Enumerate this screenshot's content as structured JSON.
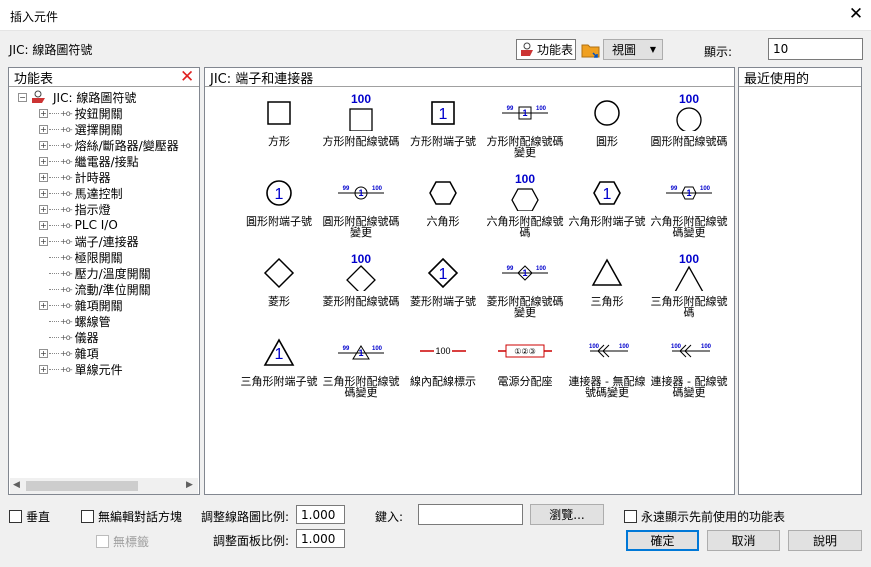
{
  "window": {
    "title": "插入元件",
    "close": "✕"
  },
  "header": {
    "library": "JIC: 線路圖符號",
    "menu_button": "功能表",
    "view_button": "視圖",
    "display_label": "顯示:",
    "display_value": "10"
  },
  "left_panel": {
    "title": "功能表",
    "root": "JIC: 線路圖符號",
    "items": [
      {
        "label": "按鈕開關",
        "expandable": true
      },
      {
        "label": "選擇開關",
        "expandable": true
      },
      {
        "label": "熔絲/斷路器/變壓器",
        "expandable": true
      },
      {
        "label": "繼電器/接點",
        "expandable": true
      },
      {
        "label": "計時器",
        "expandable": true
      },
      {
        "label": "馬達控制",
        "expandable": true
      },
      {
        "label": "指示燈",
        "expandable": true
      },
      {
        "label": "PLC I/O",
        "expandable": true
      },
      {
        "label": "端子/連接器",
        "expandable": true
      },
      {
        "label": "極限開關",
        "expandable": false
      },
      {
        "label": "壓力/溫度開關",
        "expandable": false
      },
      {
        "label": "流動/準位開關",
        "expandable": false
      },
      {
        "label": "雜項開關",
        "expandable": true
      },
      {
        "label": "螺線管",
        "expandable": false
      },
      {
        "label": "儀器",
        "expandable": false
      },
      {
        "label": "雜項",
        "expandable": true
      },
      {
        "label": "單線元件",
        "expandable": true
      }
    ]
  },
  "center_panel": {
    "title": "JIC: 端子和連接器",
    "symbols": [
      {
        "icon": "square-icon",
        "label": "方形"
      },
      {
        "icon": "square-wire-number-icon",
        "label": "方形附配線號碼"
      },
      {
        "icon": "square-terminal-number-icon",
        "label": "方形附端子號"
      },
      {
        "icon": "square-wire-number-change-icon",
        "label": "方形附配線號碼變更"
      },
      {
        "icon": "circle-icon",
        "label": "圓形"
      },
      {
        "icon": "circle-wire-number-icon",
        "label": "圓形附配線號碼"
      },
      {
        "icon": "circle-terminal-number-icon",
        "label": "圓形附端子號"
      },
      {
        "icon": "circle-wire-number-change-icon",
        "label": "圓形附配線號碼變更"
      },
      {
        "icon": "hexagon-icon",
        "label": "六角形"
      },
      {
        "icon": "hexagon-wire-number-icon",
        "label": "六角形附配線號碼"
      },
      {
        "icon": "hexagon-terminal-number-icon",
        "label": "六角形附端子號"
      },
      {
        "icon": "hexagon-wire-number-change-icon",
        "label": "六角形附配線號碼變更"
      },
      {
        "icon": "diamond-icon",
        "label": "菱形"
      },
      {
        "icon": "diamond-wire-number-icon",
        "label": "菱形附配線號碼"
      },
      {
        "icon": "diamond-terminal-number-icon",
        "label": "菱形附端子號"
      },
      {
        "icon": "diamond-wire-number-change-icon",
        "label": "菱形附配線號碼變更"
      },
      {
        "icon": "triangle-icon",
        "label": "三角形"
      },
      {
        "icon": "triangle-wire-number-icon",
        "label": "三角形附配線號碼"
      },
      {
        "icon": "triangle-terminal-number-icon",
        "label": "三角形附端子號"
      },
      {
        "icon": "triangle-wire-number-change-icon",
        "label": "三角形附配線號碼變更"
      },
      {
        "icon": "inline-wire-label-icon",
        "label": "線內配線標示"
      },
      {
        "icon": "power-distribution-icon",
        "label": "電源分配座"
      },
      {
        "icon": "connector-no-wire-number-icon",
        "label": "連接器 - 無配線號碼變更"
      },
      {
        "icon": "connector-wire-number-icon",
        "label": "連接器 - 配線號碼變更"
      }
    ],
    "glyph_text": {
      "n100": "100",
      "n99": "99",
      "n1": "1",
      "n123": "①②③"
    }
  },
  "right_panel": {
    "title": "最近使用的"
  },
  "footer": {
    "vertical": "垂直",
    "no_edit_dialog": "無編輯對話方塊",
    "no_tag": "無標籤",
    "schematic_scale_label": "調整線路圖比例:",
    "schematic_scale": "1.000",
    "panel_scale_label": "調整面板比例:",
    "panel_scale": "1.000",
    "type_label": "鍵入:",
    "type_value": "",
    "browse": "瀏覽...",
    "always_show": "永遠顯示先前使用的功能表",
    "ok": "確定",
    "cancel": "取消",
    "help": "說明"
  },
  "colors": {
    "accent": "#0078d7",
    "symbol_blue": "#0000cc",
    "close_red": "#e02020"
  }
}
